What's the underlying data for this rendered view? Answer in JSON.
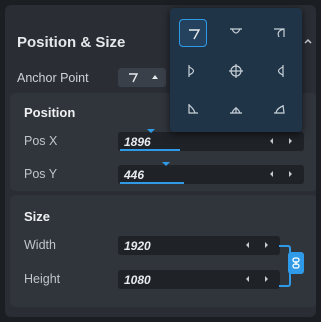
{
  "header": {
    "title": "Position & Size"
  },
  "anchor": {
    "label": "Anchor Point"
  },
  "position": {
    "title": "Position",
    "pos_x": {
      "label": "Pos X",
      "value": "1896"
    },
    "pos_y": {
      "label": "Pos Y",
      "value": "446"
    }
  },
  "size": {
    "title": "Size",
    "width": {
      "label": "Width",
      "value": "1920"
    },
    "height": {
      "label": "Height",
      "value": "1080"
    }
  },
  "colors": {
    "accent": "#2f9be8",
    "panel": "#2a2e34",
    "popup": "#1f3447"
  },
  "anchor_options": [
    "anchor-top-left-icon",
    "anchor-top-center-icon",
    "anchor-top-right-icon",
    "anchor-middle-left-icon",
    "anchor-center-icon",
    "anchor-middle-right-icon",
    "anchor-bottom-left-icon",
    "anchor-bottom-center-icon",
    "anchor-bottom-right-icon"
  ]
}
